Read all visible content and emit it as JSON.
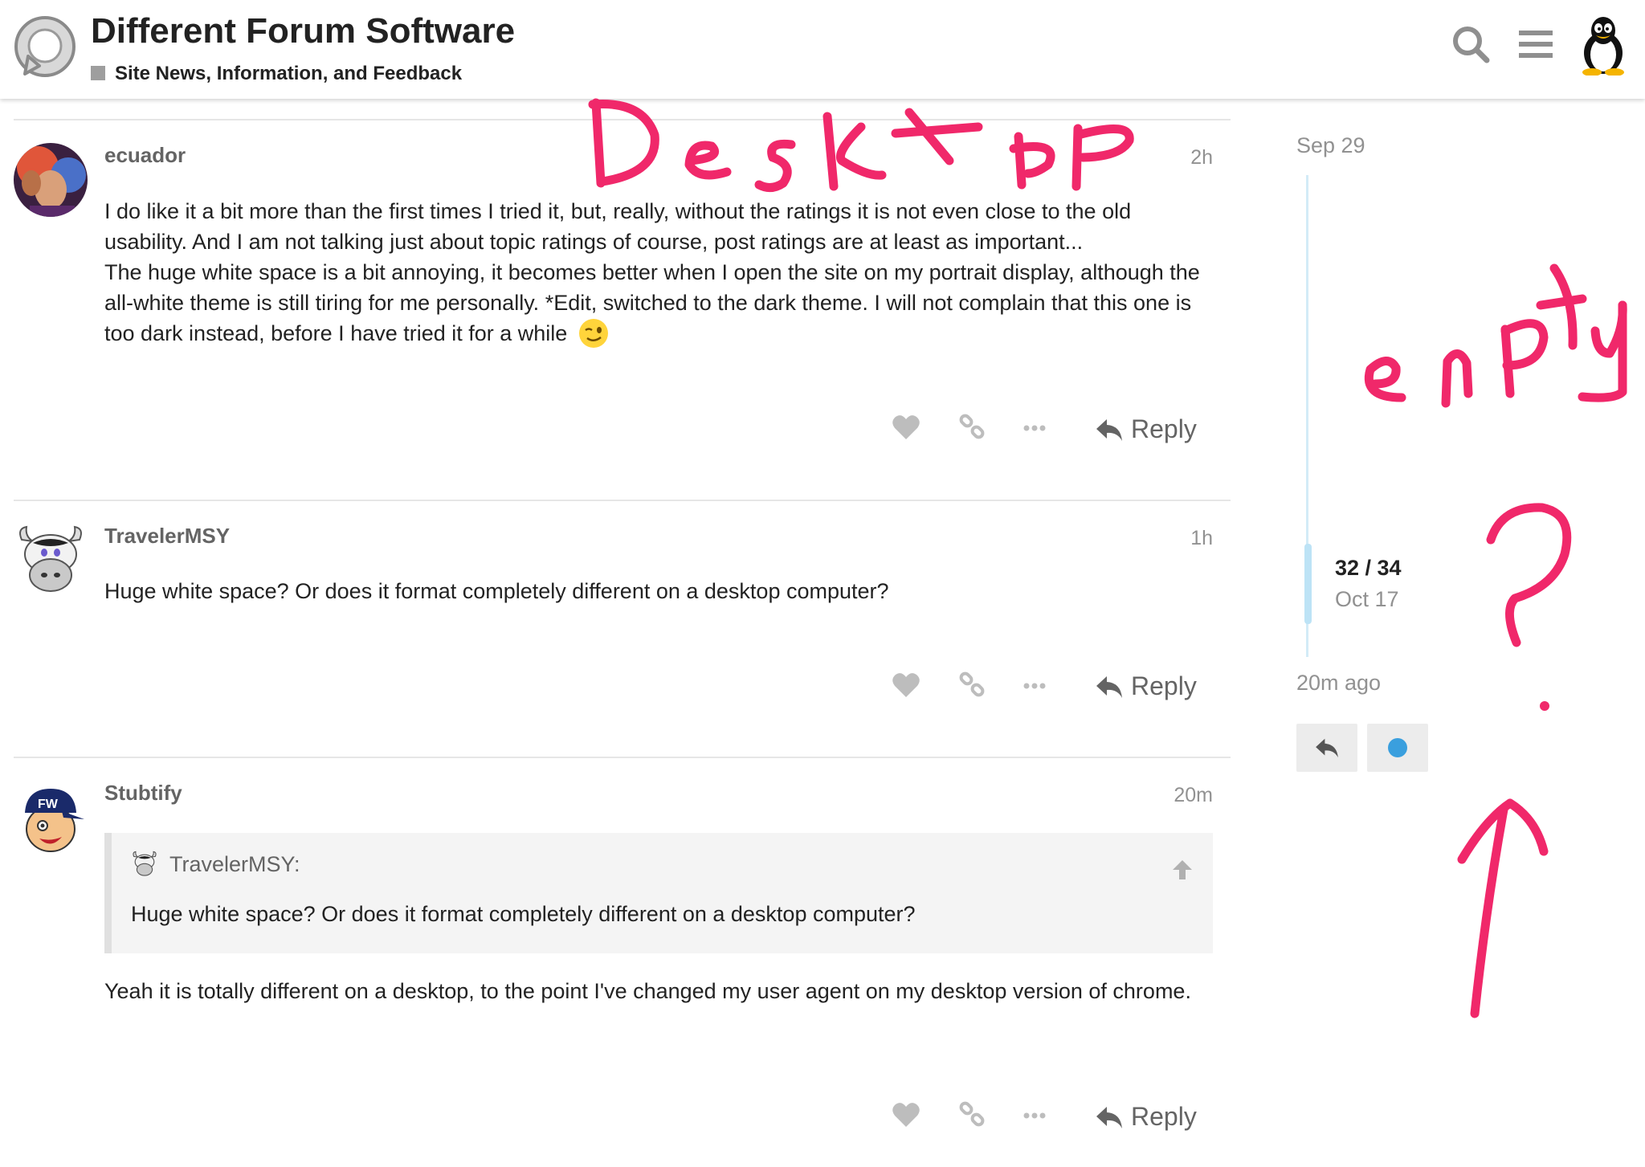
{
  "header": {
    "title": "Different Forum Software",
    "category": "Site News, Information, and Feedback",
    "category_color": "#9e9e9e",
    "icons": [
      "discourse-logo-icon",
      "search-icon",
      "hamburger-menu-icon",
      "tux-avatar"
    ]
  },
  "posts": [
    {
      "username": "ecuador",
      "time": "2h",
      "paragraphs": [
        "I do like it a bit more than the first times I tried it, but, really, without the ratings it is not even close to the old usability. And I am not talking just about topic ratings of course, post ratings are at least as important...",
        "The huge white space is a bit annoying, it becomes better when I open the site on my portrait display, although the all-white theme is still tiring for me personally. *Edit, switched to the dark theme. I will not complain that this one is too dark instead, before I have tried it for a while"
      ],
      "emoji": "wink-emoji",
      "reply_label": "Reply"
    },
    {
      "username": "TravelerMSY",
      "time": "1h",
      "paragraphs": [
        "Huge white space? Or does it format completely different on a desktop computer?"
      ],
      "reply_label": "Reply"
    },
    {
      "username": "Stubtify",
      "time": "20m",
      "quote": {
        "author": "TravelerMSY:",
        "text": "Huge white space? Or does it format completely different on a desktop computer?"
      },
      "paragraphs": [
        "Yeah it is totally different on a desktop, to the point I've changed my user agent on my desktop version of chrome."
      ],
      "reply_label": "Reply"
    }
  ],
  "timeline": {
    "start_date": "Sep 29",
    "position": "32 / 34",
    "current_date": "Oct 17",
    "last_activity": "20m ago",
    "accent_color": "#3a9fde"
  },
  "annotations": {
    "color": "#f0286a",
    "words": [
      "Desktop",
      "empty"
    ]
  }
}
